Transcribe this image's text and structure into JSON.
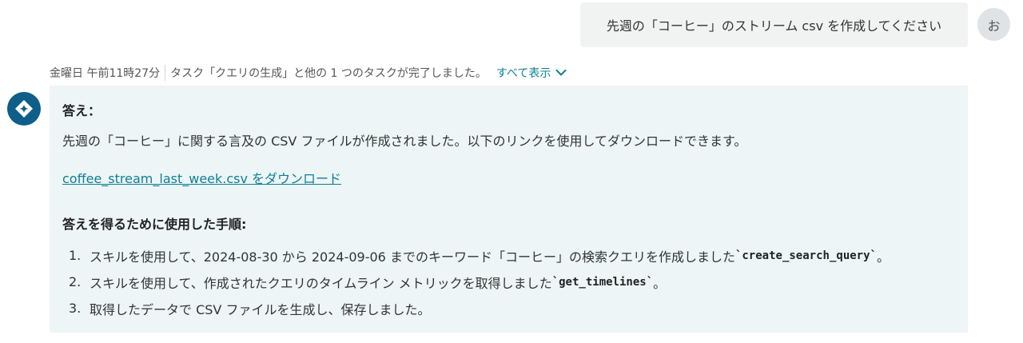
{
  "user_message": {
    "text": "先週の「コーヒー」のストリーム csv を作成してください",
    "avatar_initial": "お"
  },
  "meta": {
    "timestamp": "金曜日 午前11時27分",
    "status": "タスク「クエリの生成」と他の 1 つのタスクが完了しました。",
    "show_all_label": "すべて表示"
  },
  "bot": {
    "icon": "sparkle-diamond-icon"
  },
  "answer": {
    "heading": "答え：",
    "body": "先週の「コーヒー」に関する言及の CSV ファイルが作成されました。以下のリンクを使用してダウンロードできます。",
    "download_link": "coffee_stream_last_week.csv をダウンロード",
    "steps_heading": "答えを得るために使用した手順:",
    "steps": [
      {
        "num": "1.",
        "text": "スキルを使用して、2024-08-30 から 2024-09-06 までのキーワード「コーヒー」の検索クエリを作成しました",
        "code": "`create_search_query`",
        "after": "。"
      },
      {
        "num": "2.",
        "text": "スキルを使用して、作成されたクエリのタイムライン メトリックを取得しました",
        "code": "`get_timelines`",
        "after": "。"
      },
      {
        "num": "3.",
        "text": "取得したデータで CSV ファイルを生成し、保存しました。",
        "code": "",
        "after": ""
      }
    ]
  },
  "colors": {
    "accent": "#0f7f95",
    "bot_avatar": "#0f5d89",
    "answer_bg": "#edf5f6",
    "user_bubble_bg": "#f1f2f2"
  }
}
